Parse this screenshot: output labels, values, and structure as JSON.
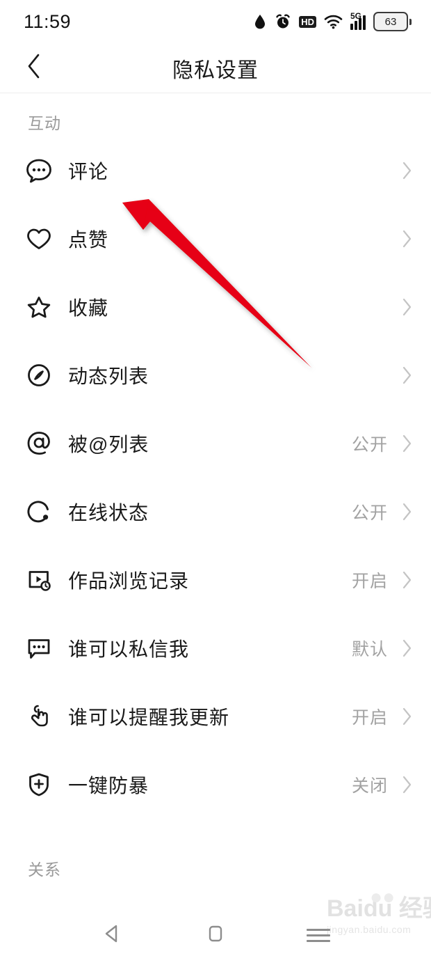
{
  "status_bar": {
    "time": "11:59",
    "icons": [
      "water-drop-icon",
      "alarm-clock-icon",
      "hd-icon",
      "wifi-icon",
      "signal-5g-icon"
    ],
    "hd_label": "HD",
    "network_label": "5G",
    "battery_level": "63"
  },
  "header": {
    "title": "隐私设置",
    "back_icon": "chevron-left-icon"
  },
  "sections": [
    {
      "label": "互动",
      "items": [
        {
          "icon": "comment-bubble-icon",
          "label": "评论",
          "value": ""
        },
        {
          "icon": "heart-icon",
          "label": "点赞",
          "value": ""
        },
        {
          "icon": "star-icon",
          "label": "收藏",
          "value": ""
        },
        {
          "icon": "compass-icon",
          "label": "动态列表",
          "value": ""
        },
        {
          "icon": "at-mention-icon",
          "label": "被@列表",
          "value": "公开"
        },
        {
          "icon": "online-status-icon",
          "label": "在线状态",
          "value": "公开"
        },
        {
          "icon": "video-history-icon",
          "label": "作品浏览记录",
          "value": "开启"
        },
        {
          "icon": "message-bubble-icon",
          "label": "谁可以私信我",
          "value": "默认"
        },
        {
          "icon": "tap-hand-icon",
          "label": "谁可以提醒我更新",
          "value": "开启"
        },
        {
          "icon": "shield-plus-icon",
          "label": "一键防暴",
          "value": "关闭"
        }
      ]
    },
    {
      "label": "关系",
      "items": []
    }
  ],
  "annotation": {
    "type": "arrow",
    "color": "#e60012",
    "points_at": "评论"
  },
  "nav_bar": {
    "back": "triangle-back-icon",
    "home": "square-home-icon",
    "recents": "hamburger-recents-icon"
  },
  "watermark": {
    "main": "Baidu 经验",
    "sub": "jingyan.baidu.com",
    "paw": "paw-print-icon"
  }
}
